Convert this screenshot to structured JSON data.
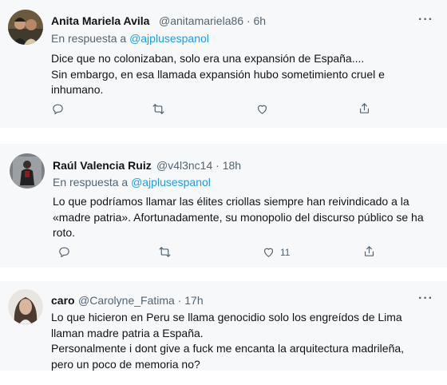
{
  "tweets": [
    {
      "author_name": "Anita Mariela Avila",
      "handle": "@anitamariela86",
      "time": "6h",
      "reply_prefix": "En respuesta a",
      "reply_to": "@ajplusespanol",
      "lines": [
        "Dice que no colonizaban, solo era una expansión de España....",
        "Sin embargo, en esa llamada expansión hubo sometimiento cruel e",
        "inhumano."
      ],
      "like_count": ""
    },
    {
      "author_name": "Raúl Valencia Ruiz",
      "handle": "@v4l3nc14",
      "time": "18h",
      "reply_prefix": "En respuesta a",
      "reply_to": "@ajplusespanol",
      "lines": [
        "Lo que podríamos llamar las élites criollas siempre han reivindicado a la",
        "«madre patria». Afortunadamente, su monopolio del discurso público se ha",
        "roto."
      ],
      "like_count": "11"
    },
    {
      "author_name": "caro",
      "handle": "@Carolyne_Fatima",
      "time": "17h",
      "lines": [
        "Lo que hicieron en Peru se llama genocidio solo los engreídos de Lima",
        "llaman madre patria a España.",
        "Personalmente i dont give a fuck me encanta la arquitectura madrileña,",
        "pero un poco de memoria no?"
      ]
    }
  ],
  "ui": {
    "separator": "·",
    "more_label": "···"
  },
  "icons": [
    "reply-icon",
    "retweet-icon",
    "like-icon",
    "share-icon",
    "more-icon"
  ],
  "colors": {
    "link": "#1d9bf0",
    "muted": "#536471",
    "text": "#0f1419",
    "card": "#f7f8f9"
  }
}
